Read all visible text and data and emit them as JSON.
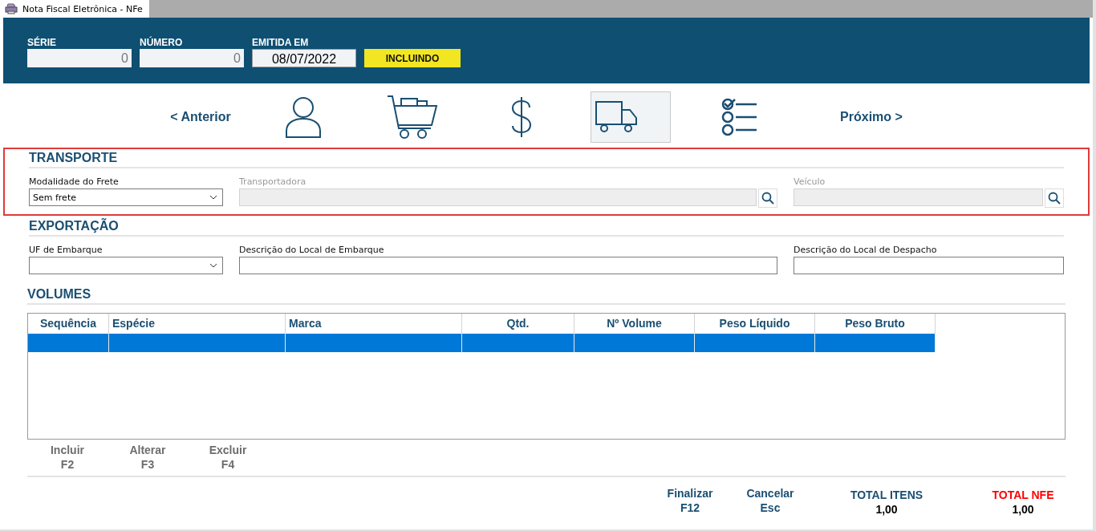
{
  "window": {
    "title": "Nota Fiscal Eletrônica - NFe"
  },
  "header": {
    "fields": [
      {
        "label": "SÉRIE",
        "value": "0",
        "kind": "number"
      },
      {
        "label": "NÚMERO",
        "value": "0",
        "kind": "number"
      },
      {
        "label": "EMITIDA EM",
        "value": "08/07/2022",
        "kind": "date"
      }
    ],
    "status": "INCLUINDO"
  },
  "nav": {
    "previous": "< Anterior",
    "next": "Próximo >",
    "steps": [
      {
        "kind": "person",
        "selected": false
      },
      {
        "kind": "cart",
        "selected": false
      },
      {
        "kind": "dollar",
        "selected": false
      },
      {
        "kind": "truck",
        "selected": true
      },
      {
        "kind": "checklist",
        "selected": false
      }
    ]
  },
  "sections": [
    {
      "title": "TRANSPORTE",
      "highlighted": true,
      "fields": [
        {
          "label": "Modalidade do Frete",
          "kind": "select",
          "value": "Sem frete",
          "disabled": false
        },
        {
          "label": "Transportadora",
          "kind": "lookup",
          "disabled": true
        },
        {
          "label": "Veículo",
          "kind": "lookup",
          "disabled": true
        }
      ]
    },
    {
      "title": "EXPORTAÇÃO",
      "highlighted": false,
      "fields": [
        {
          "label": "UF de Embarque",
          "kind": "select",
          "disabled": false
        },
        {
          "label": "Descrição do Local de Embarque",
          "kind": "text",
          "disabled": false
        },
        {
          "label": "Descrição do Local de Despacho",
          "kind": "text",
          "disabled": false
        }
      ]
    }
  ],
  "volumes": {
    "title": "VOLUMES",
    "columns": [
      "Sequência",
      "Espécie",
      "Marca",
      "Qtd.",
      "Nº Volume",
      "Peso Líquido",
      "Peso Bruto"
    ],
    "rows": [
      {
        "selected": true
      }
    ],
    "actions": [
      {
        "label": "Incluir",
        "key": "F2"
      },
      {
        "label": "Alterar",
        "key": "F3"
      },
      {
        "label": "Excluir",
        "key": "F4"
      }
    ]
  },
  "footer": {
    "actions": [
      {
        "label": "Finalizar",
        "key": "F12"
      },
      {
        "label": "Cancelar",
        "key": "Esc"
      }
    ],
    "totals": [
      {
        "label": "TOTAL ITENS",
        "value": "1,00",
        "emphasis": false
      },
      {
        "label": "TOTAL NFE",
        "value": "1,00",
        "emphasis": true
      }
    ]
  }
}
